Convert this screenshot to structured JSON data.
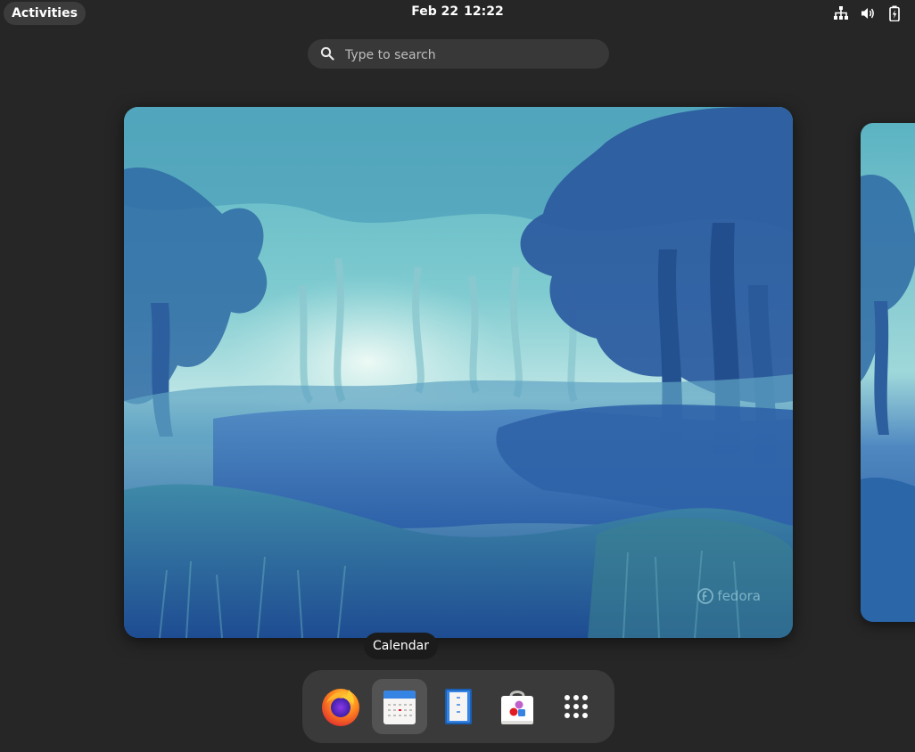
{
  "topbar": {
    "activities_label": "Activities",
    "date": "Feb 22",
    "time": "12:22",
    "tray_icons": [
      "network-icon",
      "volume-icon",
      "battery-icon"
    ]
  },
  "search": {
    "placeholder": "Type to search",
    "value": ""
  },
  "workspace": {
    "watermark": "fedora"
  },
  "tooltip": {
    "label": "Calendar"
  },
  "dock": {
    "items": [
      {
        "icon": "firefox-icon",
        "active": false
      },
      {
        "icon": "calendar-icon",
        "active": true
      },
      {
        "icon": "files-icon",
        "active": false
      },
      {
        "icon": "software-icon",
        "active": false
      },
      {
        "icon": "app-grid-icon",
        "active": false
      }
    ]
  },
  "colors": {
    "panel": "#262626",
    "accent_blue": "#3584e4",
    "wallpaper_deep": "#1f4f98",
    "wallpaper_light": "#cfeef0"
  }
}
